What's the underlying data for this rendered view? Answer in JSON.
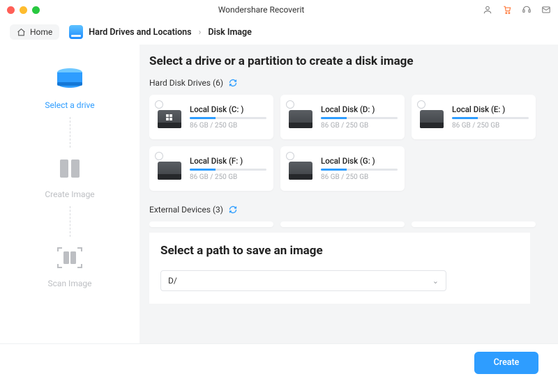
{
  "app_title": "Wondershare Recoverit",
  "home_label": "Home",
  "breadcrumb": {
    "items": [
      "Hard Drives and Locations",
      "Disk Image"
    ]
  },
  "sidebar": {
    "steps": [
      {
        "label": "Select a drive"
      },
      {
        "label": "Create Image"
      },
      {
        "label": "Scan Image"
      }
    ]
  },
  "section1_title": "Select a drive or a partition to create a disk image",
  "group_hard_drives": {
    "label": "Hard Disk Drives",
    "count": 6
  },
  "group_external": {
    "label": "External Devices",
    "count": 3
  },
  "drives": [
    {
      "name": "Local Disk (C: )",
      "meta": "86 GB / 250 GB",
      "variant": "win"
    },
    {
      "name": "Local Disk (D: )",
      "meta": "86 GB / 250 GB",
      "variant": "plain"
    },
    {
      "name": "Local Disk (E: )",
      "meta": "86 GB / 250 GB",
      "variant": "plain"
    },
    {
      "name": "Local Disk (F: )",
      "meta": "86 GB / 250 GB",
      "variant": "plain"
    },
    {
      "name": "Local Disk (G: )",
      "meta": "86 GB / 250 GB",
      "variant": "plain"
    }
  ],
  "section2_title": "Select a path to save an image",
  "path_value": "D/",
  "create_label": "Create"
}
